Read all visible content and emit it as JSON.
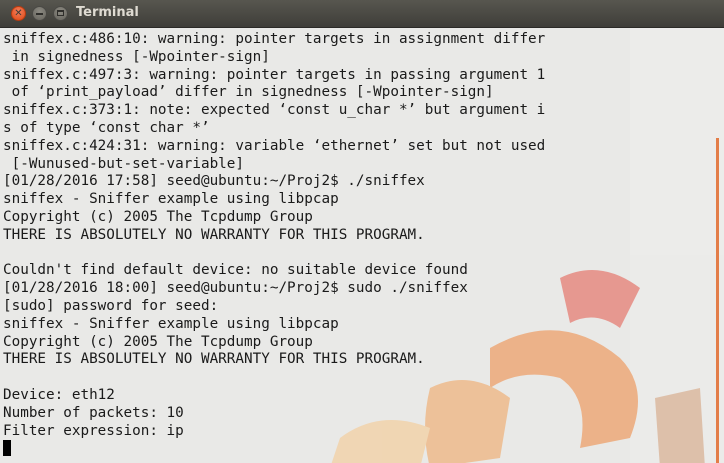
{
  "window": {
    "title": "Terminal",
    "buttons": {
      "close": "✕",
      "minimize": "",
      "maximize": ""
    }
  },
  "terminal": {
    "lines": [
      "sniffex.c:486:10: warning: pointer targets in assignment differ",
      " in signedness [-Wpointer-sign]",
      "sniffex.c:497:3: warning: pointer targets in passing argument 1",
      " of ‘print_payload’ differ in signedness [-Wpointer-sign]",
      "sniffex.c:373:1: note: expected ‘const u_char *’ but argument i",
      "s of type ‘const char *’",
      "sniffex.c:424:31: warning: variable ‘ethernet’ set but not used",
      " [-Wunused-but-set-variable]",
      "[01/28/2016 17:58] seed@ubuntu:~/Proj2$ ./sniffex",
      "sniffex - Sniffer example using libpcap",
      "Copyright (c) 2005 The Tcpdump Group",
      "THERE IS ABSOLUTELY NO WARRANTY FOR THIS PROGRAM.",
      "",
      "Couldn't find default device: no suitable device found",
      "[01/28/2016 18:00] seed@ubuntu:~/Proj2$ sudo ./sniffex",
      "[sudo] password for seed:",
      "sniffex - Sniffer example using libpcap",
      "Copyright (c) 2005 The Tcpdump Group",
      "THERE IS ABSOLUTELY NO WARRANTY FOR THIS PROGRAM.",
      "",
      "Device: eth12",
      "Number of packets: 10",
      "Filter expression: ip"
    ]
  },
  "colors": {
    "titlebar": "#3f3e39",
    "terminal_bg": "#e9e9e7",
    "text": "#1a1a1a",
    "close_button": "#dd4814",
    "wallpaper_orange": "#f2a25a",
    "wallpaper_red": "#e5574a"
  },
  "icons": {
    "close": "close-icon",
    "minimize": "minimize-icon",
    "maximize": "maximize-icon"
  }
}
